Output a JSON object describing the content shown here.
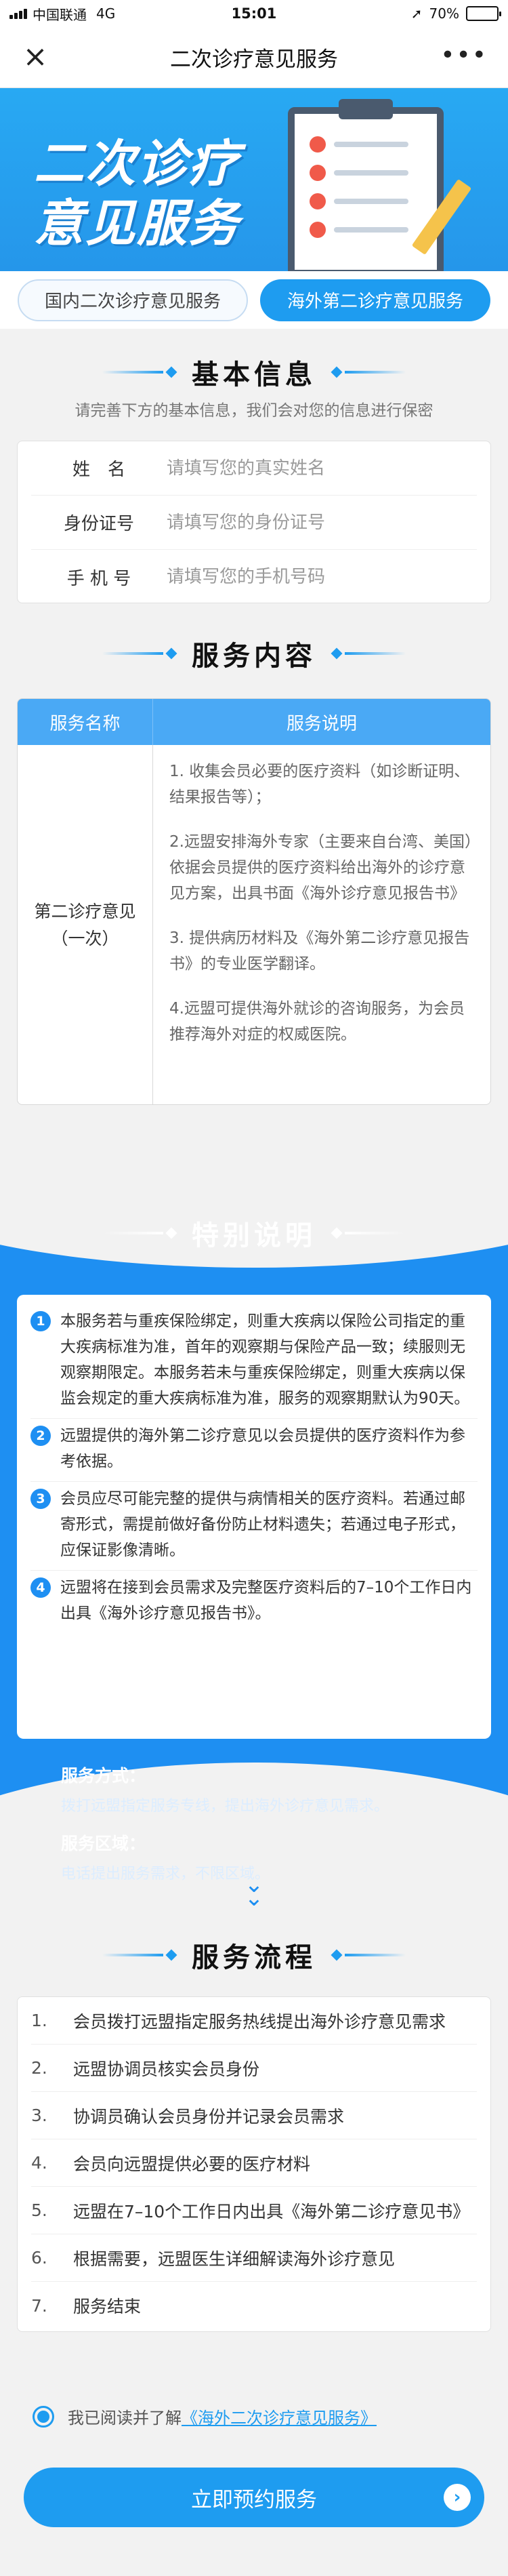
{
  "status_bar": {
    "carrier": "中国联通",
    "network": "4G",
    "time": "15:01",
    "battery": "70%",
    "battery_level": 0.7
  },
  "nav": {
    "title": "二次诊疗意见服务"
  },
  "banner": {
    "line1": "二次诊疗",
    "line2": "意见服务"
  },
  "tabs": [
    {
      "label": "国内二次诊疗意见服务",
      "active": false
    },
    {
      "label": "海外第二诊疗意见服务",
      "active": true
    }
  ],
  "basic_info": {
    "title": "基本信息",
    "subtitle": "请完善下方的基本信息，我们会对您的信息进行保密",
    "fields": [
      {
        "label": "姓　名",
        "placeholder": "请填写您的真实姓名",
        "value": ""
      },
      {
        "label": "身份证号",
        "placeholder": "请填写您的身份证号",
        "value": ""
      },
      {
        "label": "手 机 号",
        "placeholder": "请填写您的手机号码",
        "value": ""
      }
    ]
  },
  "service_content": {
    "title": "服务内容",
    "columns": [
      "服务名称",
      "服务说明"
    ],
    "service_name": "第二诊疗意见\n（一次）",
    "items": [
      "1. 收集会员必要的医疗资料（如诊断证明、结果报告等）；",
      "2.远盟安排海外专家（主要来自台湾、美国）依据会员提供的医疗资料给出海外的诊疗意见方案，出具书面《海外诊疗意见报告书》",
      "3. 提供病历材料及《海外第二诊疗意见报告书》的专业医学翻译。",
      "4.远盟可提供海外就诊的咨询服务，为会员推荐海外对症的权威医院。"
    ]
  },
  "special_notes": {
    "title": "特别说明",
    "items": [
      {
        "num": "1",
        "text": "本服务若与重疾保险绑定，则重大疾病以保险公司指定的重大疾病标准为准，首年的观察期与保险产品一致；续服则无观察期限定。本服务若未与重疾保险绑定，则重大疾病以保监会规定的重大疾病标准为准，服务的观察期默认为90天。"
      },
      {
        "num": "2",
        "text": "远盟提供的海外第二诊疗意见以会员提供的医疗资料作为参考依据。"
      },
      {
        "num": "3",
        "text": "会员应尽可能完整的提供与病情相关的医疗资料。若通过邮寄形式，需提前做好备份防止材料遗失；若通过电子形式，应保证影像清晰。"
      },
      {
        "num": "4",
        "text": "远盟将在接到会员需求及完整医疗资料后的7–10个工作日内出具《海外诊疗意见报告书》。"
      }
    ],
    "method_label": "服务方式：",
    "method_value": "拨打远盟指定服务专线，提出海外诊疗意见需求。",
    "area_label": "服务区域：",
    "area_value": "电话提出服务需求，不限区域。"
  },
  "process": {
    "title": "服务流程",
    "steps": [
      {
        "n": "1.",
        "text": "会员拨打远盟指定服务热线提出海外诊疗意见需求"
      },
      {
        "n": "2.",
        "text": "远盟协调员核实会员身份"
      },
      {
        "n": "3.",
        "text": "协调员确认会员身份并记录会员需求"
      },
      {
        "n": "4.",
        "text": "会员向远盟提供必要的医疗材料"
      },
      {
        "n": "5.",
        "text": "远盟在7–10个工作日内出具《海外第二诊疗意见书》"
      },
      {
        "n": "6.",
        "text": "根据需要，远盟医生详细解读海外诊疗意见"
      },
      {
        "n": "7.",
        "text": "服务结束"
      }
    ]
  },
  "agreement": {
    "prefix": "我已阅读并了解",
    "link": "《海外二次诊疗意见服务》",
    "checked": true
  },
  "cta": {
    "label": "立即预约服务"
  },
  "colors": {
    "primary": "#1e9cf0",
    "banner": "#28a9f3",
    "section_blue": "#1e8ff2"
  }
}
